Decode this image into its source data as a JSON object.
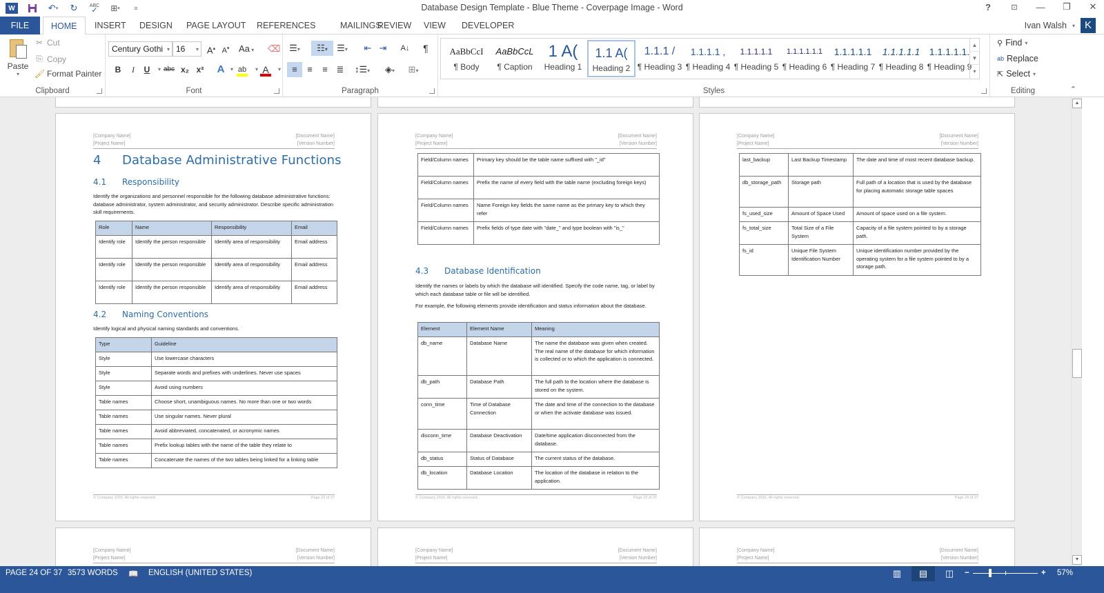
{
  "titlebar": {
    "title": "Database Design Template - Blue Theme - Coverpage Image - Word",
    "qat": [
      "word-logo",
      "save",
      "undo",
      "redo",
      "spelling",
      "touch-mode",
      "customize"
    ],
    "help": "?",
    "ribbon_display": "⊼",
    "minimize": "—",
    "restore": "❐",
    "close": "✕"
  },
  "tabs": {
    "file": "FILE",
    "items": [
      "HOME",
      "INSERT",
      "DESIGN",
      "PAGE LAYOUT",
      "REFERENCES",
      "MAILINGS",
      "REVIEW",
      "VIEW",
      "DEVELOPER"
    ],
    "active": "HOME",
    "user_name": "Ivan Walsh",
    "avatar_initial": "K"
  },
  "ribbon": {
    "clipboard": {
      "label": "Clipboard",
      "paste": "Paste",
      "cut": "Cut",
      "copy": "Copy",
      "format_painter": "Format Painter"
    },
    "font": {
      "label": "Font",
      "font_name": "Century Gothi",
      "font_size": "16",
      "change_case": "Aa",
      "bold": "B",
      "italic": "I",
      "underline": "U",
      "strikethrough": "abc",
      "subscript": "x₂",
      "superscript": "x²",
      "highlight_color": "#ffff00",
      "font_color": "#e00000"
    },
    "paragraph": {
      "label": "Paragraph",
      "pilcrow": "¶"
    },
    "styles": {
      "label": "Styles",
      "items": [
        {
          "preview": "AaBbCcI",
          "name": "¶ Body"
        },
        {
          "preview": "AaBbCcL",
          "name": "¶ Caption"
        },
        {
          "preview": "1  A(",
          "name": "Heading 1"
        },
        {
          "preview": "1.1  A(",
          "name": "Heading 2"
        },
        {
          "preview": "1.1.1 /",
          "name": "¶ Heading 3"
        },
        {
          "preview": "1.1.1.1 ,",
          "name": "¶ Heading 4"
        },
        {
          "preview": "1.1.1.1.1",
          "name": "¶ Heading 5"
        },
        {
          "preview": "1.1.1.1.1.1",
          "name": "¶ Heading 6"
        },
        {
          "preview": "1.1.1.1.1",
          "name": "¶ Heading 7"
        },
        {
          "preview": "1.1.1.1.1",
          "name": "¶ Heading 8"
        },
        {
          "preview": "1.1.1.1.1.",
          "name": "¶ Heading 9"
        }
      ],
      "selected": "Heading 2"
    },
    "editing": {
      "label": "Editing",
      "find": "Find",
      "replace": "Replace",
      "select": "Select"
    }
  },
  "pages": {
    "header": {
      "company": "[Company Name]",
      "project": "[Project Name]",
      "document": "[Document Name]",
      "version": "[Version Number]"
    },
    "footer_copyright": "© Company 2016. All rights reserved.",
    "page22": {
      "footer_page": "Page 22 of 37",
      "h1_num": "4",
      "h1_text": "Database Administrative Functions",
      "s41_num": "4.1",
      "s41_text": "Responsibility",
      "s41_para": "Identify the organizations and personnel responsible for the following database administrative functions: database administrator, system administrator, and security administrator.  Describe specific administration skill requirements.",
      "resp_table": {
        "headers": [
          "Role",
          "Name",
          "Responsibility",
          "Email"
        ],
        "rows": [
          [
            "Identify role",
            "Identify the person responsible",
            "Identify area of responsibility",
            "Email address"
          ],
          [
            "Identify role",
            "Identify the person responsible",
            "Identify area of responsibility",
            "Email address"
          ],
          [
            "Identify role",
            "Identify the person responsible",
            "Identify area of responsibility",
            "Email address"
          ]
        ]
      },
      "s42_num": "4.2",
      "s42_text": "Naming Conventions",
      "s42_para": "Identify logical and physical naming standards and conventions.",
      "naming_table": {
        "headers": [
          "Type",
          "Guideline"
        ],
        "rows": [
          [
            "Style",
            "Use lowercase characters"
          ],
          [
            "Style",
            "Separate words and prefixes with underlines. Never use spaces"
          ],
          [
            "Style",
            "Avoid using numbers"
          ],
          [
            "Table names",
            "Choose short, unambiguous names. No more than one or two words"
          ],
          [
            "Table names",
            "Use singular names. Never plural"
          ],
          [
            "Table names",
            "Avoid abbreviated, concatenated, or acronymic names"
          ],
          [
            "Table names",
            "Prefix lookup tables with the name of the table they relate to"
          ],
          [
            "Table names",
            "Concatenate the names of the two tables being linked for a linking table"
          ]
        ]
      }
    },
    "page23": {
      "footer_page": "Page 23 of 37",
      "naming_cont_table": {
        "rows": [
          [
            "Field/Column names",
            "Primary key should be the table name suffixed with \"_id\""
          ],
          [
            "Field/Column names",
            "Prefix the name of every field with the table name (excluding foreign keys)"
          ],
          [
            "Field/Column names",
            "Name Foreign key fields the same name as the primary key to which they refer"
          ],
          [
            "Field/Column names",
            "Prefix fields of type date with \"date_\" and type boolean with \"is_\""
          ]
        ]
      },
      "s43_num": "4.3",
      "s43_text": "Database Identification",
      "s43_para1": "Identify the names or labels by which the database will identified. Specify the code name, tag, or label by which each database table or file will be identified.",
      "s43_para2": "For example, the following elements provide identification and status information about the database.",
      "ident_table": {
        "headers": [
          "Element",
          "Element Name",
          "Meaning"
        ],
        "rows": [
          [
            "db_name",
            "Database Name",
            "The name the database was given when created. The real name of the database for which information is collected or to which the application is connected."
          ],
          [
            "db_path",
            "Database Path",
            "The full path to the location where the database is stored on the system."
          ],
          [
            "conn_time",
            "Time of Database Connection",
            "The date and time of the connection to the database or when the activate database was issued."
          ],
          [
            "disconn_time",
            "Database Deactivation",
            "Date/time application disconnected from the database."
          ],
          [
            "db_status",
            "Status of Database",
            "The current status of the database."
          ],
          [
            "db_location",
            "Database Location",
            "The location of the database in relation to the application."
          ]
        ]
      }
    },
    "page24": {
      "footer_page": "Page 24 of 37",
      "ident_cont_table": {
        "rows": [
          [
            "last_backup",
            "Last Backup Timestamp",
            "The date and time of most recent database backup."
          ],
          [
            "db_storage_path",
            "Storage path",
            "Full path of a location that is used by the database for placing automatic storage table spaces"
          ],
          [
            "fs_used_size",
            "Amount of Space Used",
            "Amount of space used on a file system."
          ],
          [
            "fs_total_size",
            "Total Size of a File System",
            "Capacity of a file system pointed to by a storage path."
          ],
          [
            "fs_id",
            "Unique File System Identification Number",
            "Unique identification number provided by the operating system for a file system pointed to by a storage path."
          ]
        ]
      }
    }
  },
  "statusbar": {
    "page": "PAGE 24 OF 37",
    "words": "3573 WORDS",
    "language": "ENGLISH (UNITED STATES)",
    "zoom": "57%",
    "zoom_minus": "−",
    "zoom_plus": "+",
    "active_view": "print-layout"
  }
}
